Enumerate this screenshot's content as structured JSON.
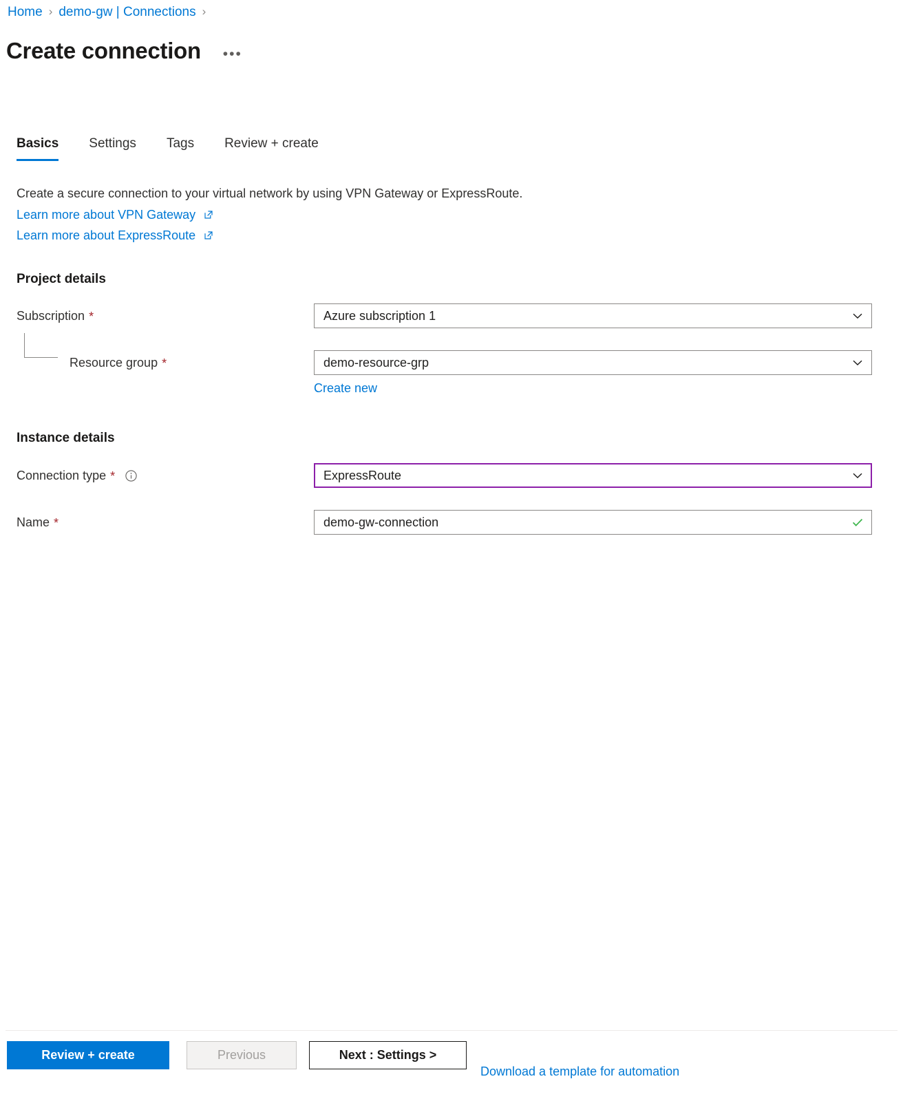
{
  "breadcrumb": {
    "items": [
      {
        "label": "Home"
      },
      {
        "label": "demo-gw | Connections"
      }
    ],
    "separator": "›"
  },
  "header": {
    "title": "Create connection",
    "more_label": "•••",
    "more_icon": "ellipsis-horizontal-icon"
  },
  "tabs": [
    {
      "label": "Basics",
      "active": true
    },
    {
      "label": "Settings",
      "active": false
    },
    {
      "label": "Tags",
      "active": false
    },
    {
      "label": "Review + create",
      "active": false
    }
  ],
  "intro": {
    "description": "Create a secure connection to your virtual network by using VPN Gateway or ExpressRoute.",
    "links": [
      {
        "label": "Learn more about VPN Gateway",
        "icon": "external-link-icon"
      },
      {
        "label": "Learn more about ExpressRoute",
        "icon": "external-link-icon"
      }
    ]
  },
  "sections": {
    "project_details": {
      "heading": "Project details",
      "subscription": {
        "label": "Subscription",
        "required_marker": "*",
        "value": "Azure subscription 1",
        "control": "dropdown"
      },
      "resource_group": {
        "label": "Resource group",
        "required_marker": "*",
        "value": "demo-resource-grp",
        "control": "dropdown",
        "create_new_label": "Create new"
      }
    },
    "instance_details": {
      "heading": "Instance details",
      "connection_type": {
        "label": "Connection type",
        "required_marker": "*",
        "value": "ExpressRoute",
        "control": "dropdown",
        "focused": true,
        "info_icon": "info-circle-icon"
      },
      "name": {
        "label": "Name",
        "required_marker": "*",
        "value": "demo-gw-connection",
        "placeholder": "",
        "control": "textbox",
        "validation_icon": "checkmark-icon",
        "valid": true
      }
    }
  },
  "footer": {
    "review_create_label": "Review + create",
    "previous_label": "Previous",
    "next_label": "Next : Settings >",
    "download_template_label": "Download a template for automation"
  },
  "colors": {
    "accent": "#0078d4",
    "focus_border": "#8c1fa9",
    "required_asterisk": "#a4262c",
    "valid_check": "#3bb44a",
    "text": "#201f1e",
    "border": "#8a8886",
    "disabled_bg": "#f3f2f1",
    "disabled_text": "#a19f9d"
  }
}
